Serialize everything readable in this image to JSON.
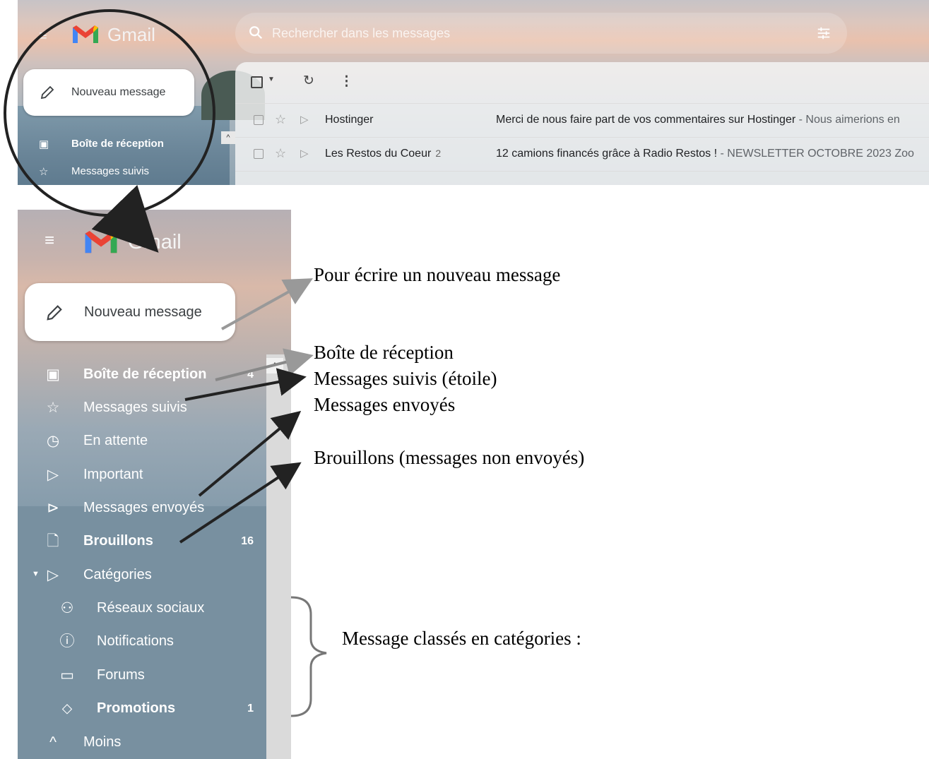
{
  "gmail": {
    "brand": "Gmail",
    "search_placeholder": "Rechercher dans les messages",
    "compose_label": "Nouveau message"
  },
  "top_nav": [
    {
      "icon": "inbox-icon",
      "label": "Boîte de réception"
    },
    {
      "icon": "star-icon",
      "label": "Messages suivis"
    }
  ],
  "emails": [
    {
      "sender": "Hostinger",
      "count": "",
      "subject": "Merci de nous faire part de vos commentaires sur Hostinger",
      "snippet": " - Nous aimerions en"
    },
    {
      "sender": "Les Restos du Coeur",
      "count": "2",
      "subject": "12 camions financés grâce à Radio Restos !",
      "snippet": " - NEWSLETTER OCTOBRE 2023 Zoo"
    }
  ],
  "side_nav": [
    {
      "icon": "inbox-icon",
      "glyph": "▣",
      "label": "Boîte de réception",
      "count": "4",
      "bold": true
    },
    {
      "icon": "star-icon",
      "glyph": "☆",
      "label": "Messages suivis",
      "count": "",
      "bold": false
    },
    {
      "icon": "clock-icon",
      "glyph": "◷",
      "label": "En attente",
      "count": "",
      "bold": false
    },
    {
      "icon": "important-icon",
      "glyph": "▷",
      "label": "Important",
      "count": "",
      "bold": false
    },
    {
      "icon": "send-icon",
      "glyph": "⊳",
      "label": "Messages envoyés",
      "count": "",
      "bold": false
    },
    {
      "icon": "draft-icon",
      "glyph": "🗋",
      "label": "Brouillons",
      "count": "16",
      "bold": true
    },
    {
      "icon": "label-icon",
      "glyph": "▷",
      "label": "Catégories",
      "count": "",
      "bold": false
    },
    {
      "icon": "people-icon",
      "glyph": "⚇",
      "label": "Réseaux sociaux",
      "count": "",
      "bold": false
    },
    {
      "icon": "info-icon",
      "glyph": "ⓘ",
      "label": "Notifications",
      "count": "",
      "bold": false
    },
    {
      "icon": "forum-icon",
      "glyph": "▭",
      "label": "Forums",
      "count": "",
      "bold": false
    },
    {
      "icon": "tag-icon",
      "glyph": "⬦",
      "label": "Promotions",
      "count": "1",
      "bold": true
    },
    {
      "icon": "chevron-up-icon",
      "glyph": "^",
      "label": "Moins",
      "count": "",
      "bold": false
    }
  ],
  "annotations": {
    "compose": "Pour écrire un nouveau message",
    "inbox": "Boîte de réception",
    "starred": "Messages suivis  (étoile)",
    "sent": "Messages envoyés",
    "drafts": "Brouillons (messages non envoyés)",
    "categories": "Message classés en catégories :"
  }
}
